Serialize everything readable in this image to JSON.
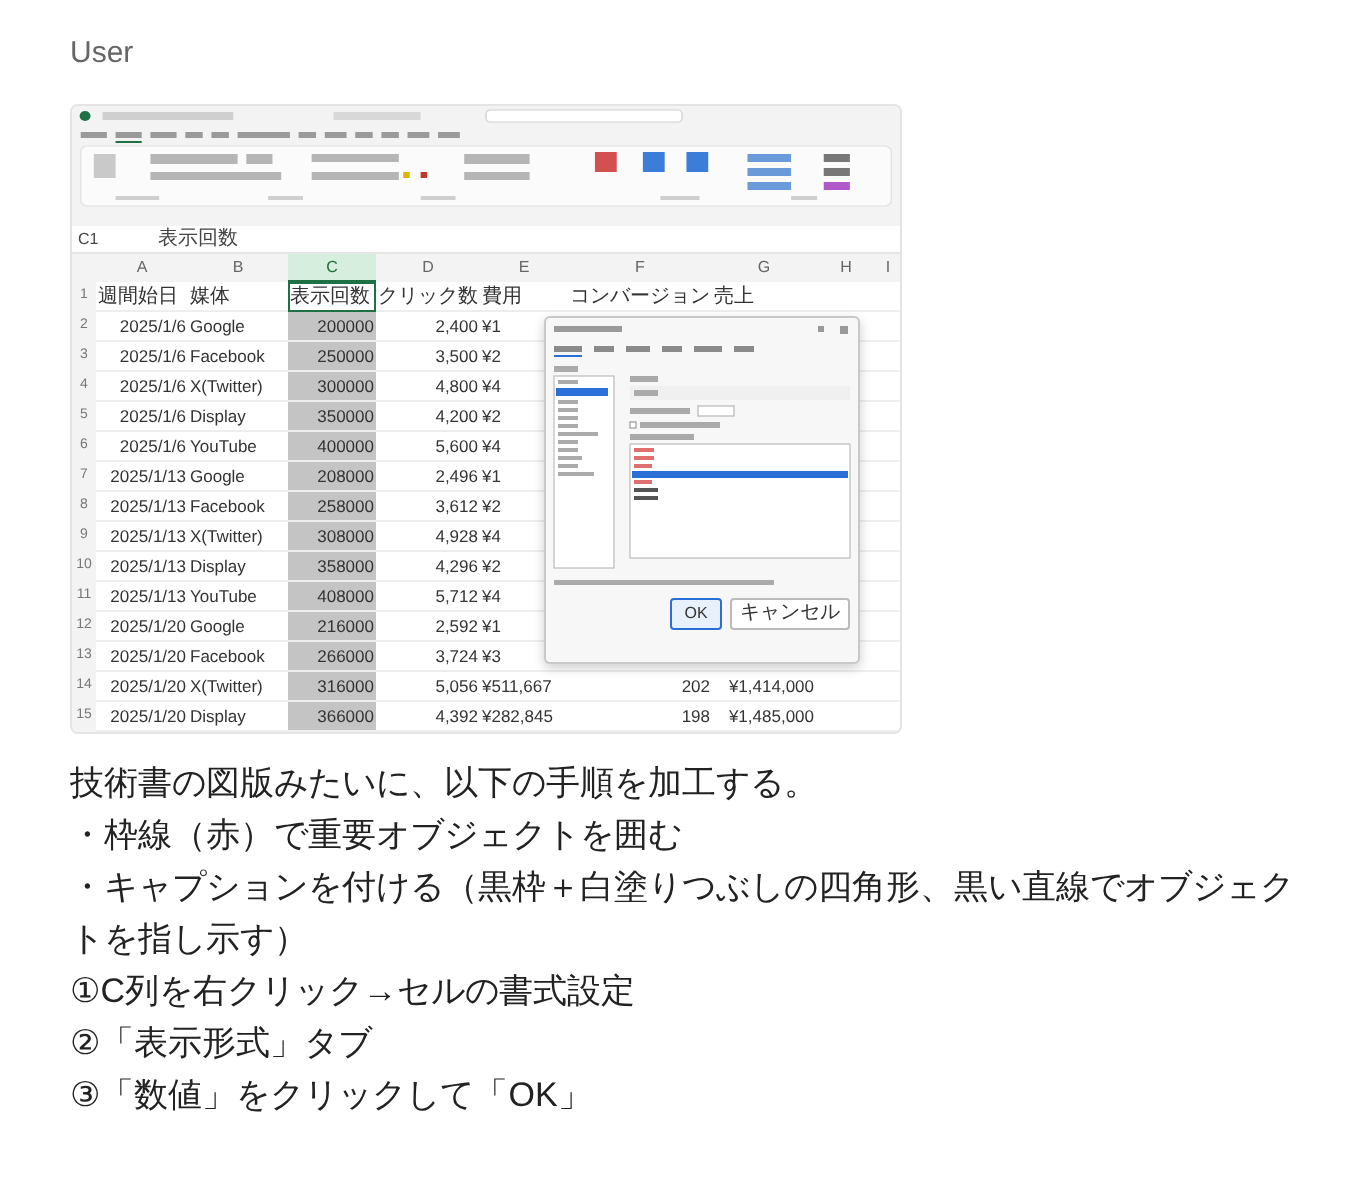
{
  "user_label": "User",
  "attachment": {
    "name_box": "C1",
    "formula": "表示回数",
    "columns": [
      {
        "label": "A",
        "selected": false
      },
      {
        "label": "B",
        "selected": false
      },
      {
        "label": "C",
        "selected": true
      },
      {
        "label": "D",
        "selected": false
      },
      {
        "label": "E",
        "selected": false
      },
      {
        "label": "F",
        "selected": false
      },
      {
        "label": "G",
        "selected": false
      },
      {
        "label": "H",
        "selected": false
      },
      {
        "label": "I",
        "selected": false
      }
    ],
    "rows": [
      {
        "number": "1",
        "kind": "header",
        "cells": [
          "週間始日",
          "媒体",
          "表示回数",
          "クリック数",
          "費用",
          "コンバージョン",
          "売上"
        ]
      },
      {
        "number": "2",
        "kind": "data",
        "cells": [
          "2025/1/6",
          "Google",
          "200000",
          "2,400",
          "¥1"
        ]
      },
      {
        "number": "3",
        "kind": "data",
        "cells": [
          "2025/1/6",
          "Facebook",
          "250000",
          "3,500",
          "¥2"
        ]
      },
      {
        "number": "4",
        "kind": "data",
        "cells": [
          "2025/1/6",
          "X(Twitter)",
          "300000",
          "4,800",
          "¥4"
        ]
      },
      {
        "number": "5",
        "kind": "data",
        "cells": [
          "2025/1/6",
          "Display",
          "350000",
          "4,200",
          "¥2"
        ]
      },
      {
        "number": "6",
        "kind": "data",
        "cells": [
          "2025/1/6",
          "YouTube",
          "400000",
          "5,600",
          "¥4"
        ]
      },
      {
        "number": "7",
        "kind": "data",
        "cells": [
          "2025/1/13",
          "Google",
          "208000",
          "2,496",
          "¥1"
        ]
      },
      {
        "number": "8",
        "kind": "data",
        "cells": [
          "2025/1/13",
          "Facebook",
          "258000",
          "3,612",
          "¥2"
        ]
      },
      {
        "number": "9",
        "kind": "data",
        "cells": [
          "2025/1/13",
          "X(Twitter)",
          "308000",
          "4,928",
          "¥4"
        ]
      },
      {
        "number": "10",
        "kind": "data",
        "cells": [
          "2025/1/13",
          "Display",
          "358000",
          "4,296",
          "¥2"
        ]
      },
      {
        "number": "11",
        "kind": "data",
        "cells": [
          "2025/1/13",
          "YouTube",
          "408000",
          "5,712",
          "¥4"
        ]
      },
      {
        "number": "12",
        "kind": "data",
        "cells": [
          "2025/1/20",
          "Google",
          "216000",
          "2,592",
          "¥1"
        ]
      },
      {
        "number": "13",
        "kind": "data",
        "cells": [
          "2025/1/20",
          "Facebook",
          "266000",
          "3,724",
          "¥3"
        ]
      },
      {
        "number": "14",
        "kind": "data",
        "cells": [
          "2025/1/20",
          "X(Twitter)",
          "316000",
          "5,056",
          "¥511,667",
          "202",
          "¥1,414,000"
        ]
      },
      {
        "number": "15",
        "kind": "data",
        "cells": [
          "2025/1/20",
          "Display",
          "366000",
          "4,392",
          "¥282,845",
          "198",
          "¥1,485,000"
        ]
      }
    ],
    "dialog": {
      "buttons": [
        {
          "label": "OK",
          "kind": "default"
        },
        {
          "label": "キャンセル",
          "kind": "normal"
        }
      ]
    }
  },
  "message_lines": [
    "技術書の図版みたいに、以下の手順を加工する。",
    "・枠線（赤）で重要オブジェクトを囲む",
    "・キャプションを付ける（黒枠＋白塗りつぶしの四角形、黒い直線でオブジェクトを指し示す）",
    "①C列を右クリック→セルの書式設定",
    "②「表示形式」タブ",
    "③「数値」をクリックして「OK」"
  ]
}
